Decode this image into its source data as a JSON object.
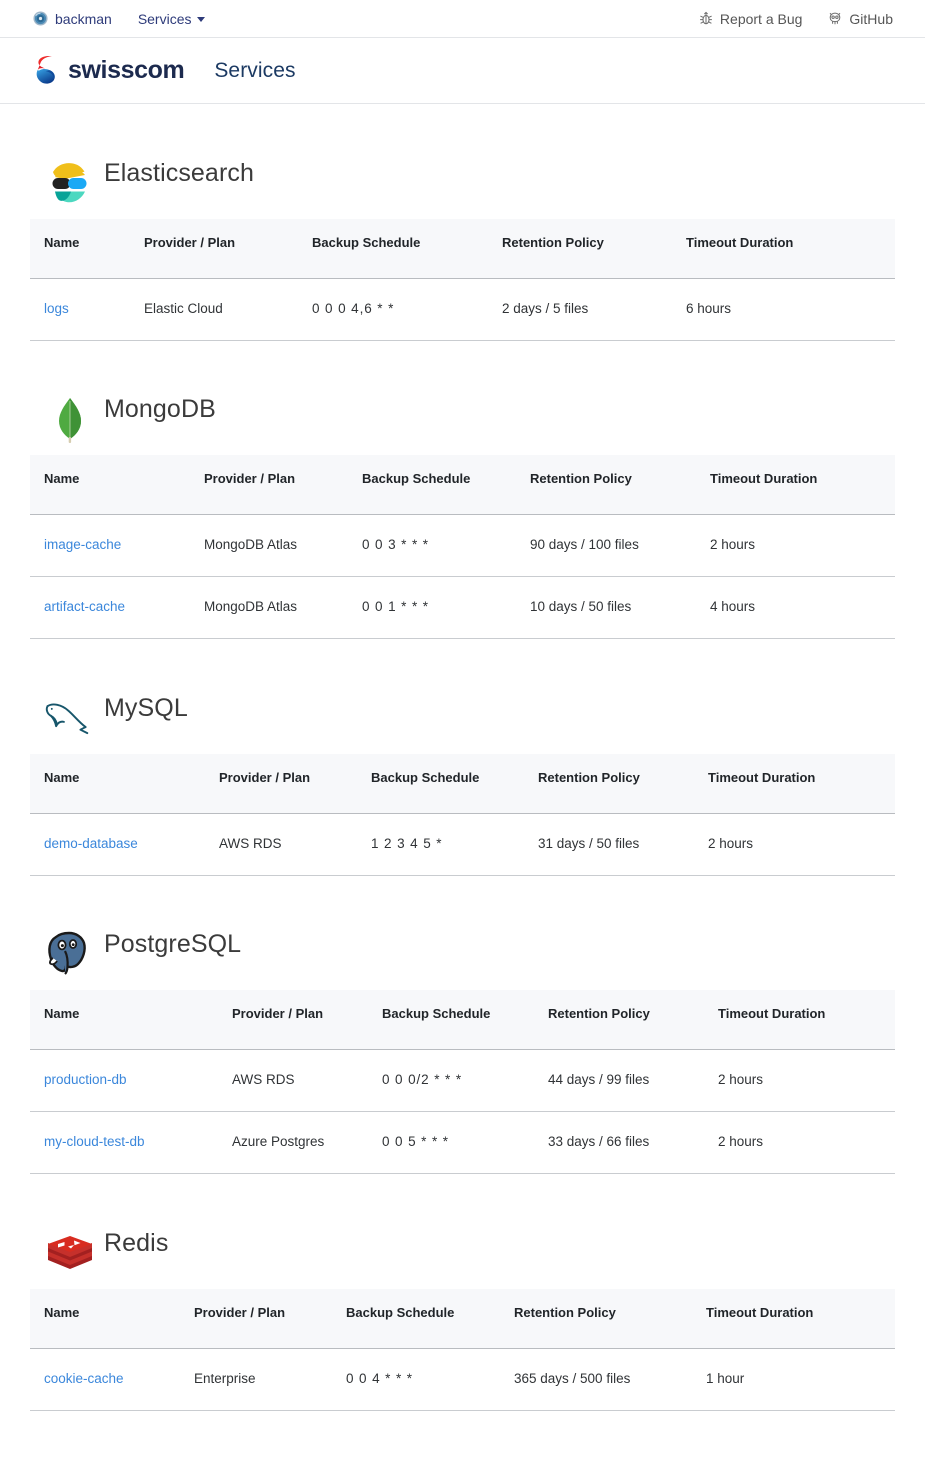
{
  "topbar": {
    "brand": "backman",
    "brand_icon": "disc-icon",
    "nav": [
      {
        "label": "Services",
        "icon": "chevron-down-icon"
      }
    ],
    "utilities": [
      {
        "label": "Report a Bug",
        "icon": "bug-icon"
      },
      {
        "label": "GitHub",
        "icon": "github-icon"
      }
    ]
  },
  "header": {
    "logo_text": "swisscom",
    "logo_icon": "swisscom-lifeform-icon",
    "title": "Services",
    "accent_red": "#e2001a",
    "accent_blue": "#1b4ea0",
    "title_color": "#1c3a63"
  },
  "colors": {
    "link": "#3b87db",
    "table_header_bg": "#f7f8fa",
    "border": "#c9ccd0",
    "nav_text": "#2e3b7a"
  },
  "columns": [
    "Name",
    "Provider / Plan",
    "Backup Schedule",
    "Retention Policy",
    "Timeout Duration"
  ],
  "services": [
    {
      "name": "Elasticsearch",
      "icon": "elasticsearch-icon",
      "columns": [
        "Name",
        "Provider / Plan",
        "Backup Schedule",
        "Retention Policy",
        "Timeout Duration"
      ],
      "rows": [
        {
          "name": "logs",
          "provider": "Elastic Cloud",
          "schedule": "0 0 0 4,6 * *",
          "retention": "2 days / 5 files",
          "timeout": "6 hours"
        }
      ]
    },
    {
      "name": "MongoDB",
      "icon": "mongodb-icon",
      "columns": [
        "Name",
        "Provider / Plan",
        "Backup Schedule",
        "Retention Policy",
        "Timeout Duration"
      ],
      "rows": [
        {
          "name": "image-cache",
          "provider": "MongoDB Atlas",
          "schedule": "0 0 3 * * *",
          "retention": "90 days / 100 files",
          "timeout": "2 hours"
        },
        {
          "name": "artifact-cache",
          "provider": "MongoDB Atlas",
          "schedule": "0 0 1 * * *",
          "retention": "10 days / 50 files",
          "timeout": "4 hours"
        }
      ]
    },
    {
      "name": "MySQL",
      "icon": "mysql-icon",
      "columns": [
        "Name",
        "Provider / Plan",
        "Backup Schedule",
        "Retention Policy",
        "Timeout Duration"
      ],
      "rows": [
        {
          "name": "demo-database",
          "provider": "AWS RDS",
          "schedule": "1 2 3 4 5 *",
          "retention": "31 days / 50 files",
          "timeout": "2 hours"
        }
      ]
    },
    {
      "name": "PostgreSQL",
      "icon": "postgresql-icon",
      "columns": [
        "Name",
        "Provider / Plan",
        "Backup Schedule",
        "Retention Policy",
        "Timeout Duration"
      ],
      "rows": [
        {
          "name": "production-db",
          "provider": "AWS RDS",
          "schedule": "0 0 0/2 * * *",
          "retention": "44 days / 99 files",
          "timeout": "2 hours"
        },
        {
          "name": "my-cloud-test-db",
          "provider": "Azure Postgres",
          "schedule": "0 0 5 * * *",
          "retention": "33 days / 66 files",
          "timeout": "2 hours"
        }
      ]
    },
    {
      "name": "Redis",
      "icon": "redis-icon",
      "columns": [
        "Name",
        "Provider / Plan",
        "Backup Schedule",
        "Retention Policy",
        "Timeout Duration"
      ],
      "rows": [
        {
          "name": "cookie-cache",
          "provider": "Enterprise",
          "schedule": "0 0 4 * * *",
          "retention": "365 days / 500 files",
          "timeout": "1 hour"
        }
      ]
    }
  ]
}
